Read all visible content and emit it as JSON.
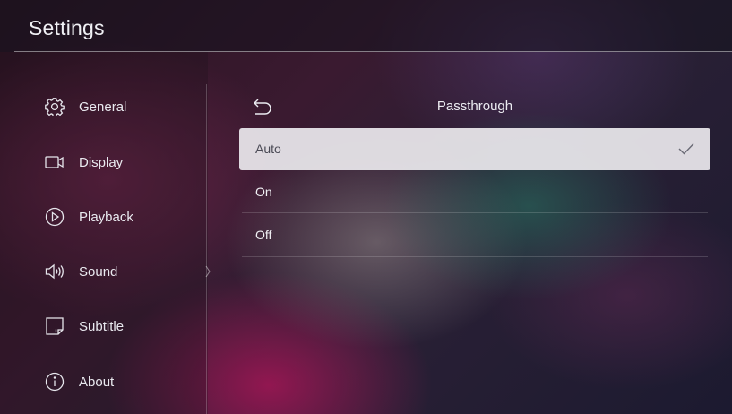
{
  "header": {
    "title": "Settings"
  },
  "sidebar": {
    "items": [
      {
        "label": "General",
        "icon": "gear-icon"
      },
      {
        "label": "Display",
        "icon": "display-icon"
      },
      {
        "label": "Playback",
        "icon": "play-circle-icon"
      },
      {
        "label": "Sound",
        "icon": "speaker-icon"
      },
      {
        "label": "Subtitle",
        "icon": "subtitle-icon"
      },
      {
        "label": "About",
        "icon": "info-icon"
      }
    ],
    "active_item": "Sound"
  },
  "panel": {
    "title": "Passthrough",
    "back_icon": "back-arrow-icon",
    "options": [
      {
        "label": "Auto",
        "selected": true
      },
      {
        "label": "On",
        "selected": false
      },
      {
        "label": "Off",
        "selected": false
      }
    ],
    "check_icon": "checkmark-icon"
  },
  "colors": {
    "selected_row_bg": "#e8e6ea",
    "selected_text": "#4a4a55",
    "text_primary": "#f0f0f4",
    "divider": "#ffffff"
  }
}
